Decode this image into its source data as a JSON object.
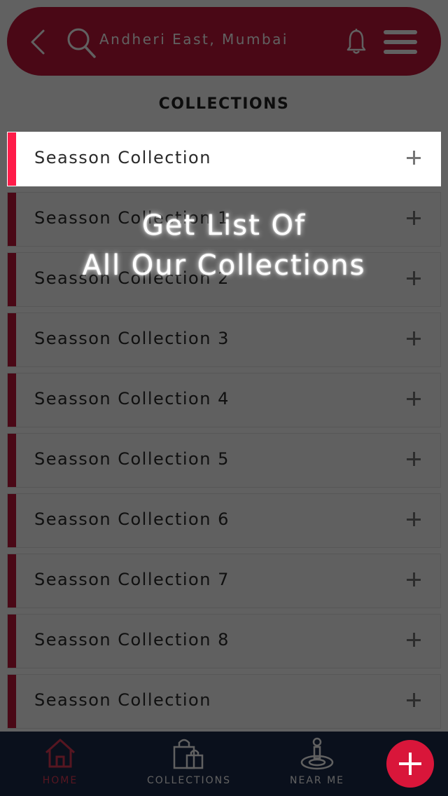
{
  "header": {
    "location": "Andheri East, Mumbai",
    "icons": [
      "back-arrow-icon",
      "search-icon",
      "bell-icon",
      "hamburger-menu-icon"
    ]
  },
  "page_title": "COLLECTIONS",
  "collections": [
    {
      "label": "Seasson Collection",
      "active": true
    },
    {
      "label": "Seasson Collection 1",
      "active": false
    },
    {
      "label": "Seasson Collection 2",
      "active": false
    },
    {
      "label": "Seasson Collection 3",
      "active": false
    },
    {
      "label": "Seasson Collection 4",
      "active": false
    },
    {
      "label": "Seasson Collection 5",
      "active": false
    },
    {
      "label": "Seasson Collection 6",
      "active": false
    },
    {
      "label": "Seasson Collection 7",
      "active": false
    },
    {
      "label": "Seasson Collection 8",
      "active": false
    },
    {
      "label": "Seasson Collection",
      "active": false
    }
  ],
  "promo": {
    "line1": "Get List Of",
    "line2": "All Our Collections"
  },
  "bottom_nav": {
    "home": "HOME",
    "collections": "COLLECTIONS",
    "near_me": "NEAR ME"
  },
  "colors": {
    "brand": "#c3173b",
    "active_stripe": "#ff1c49",
    "nav_background": "#1b2a4a",
    "fab": "#d9163a"
  }
}
